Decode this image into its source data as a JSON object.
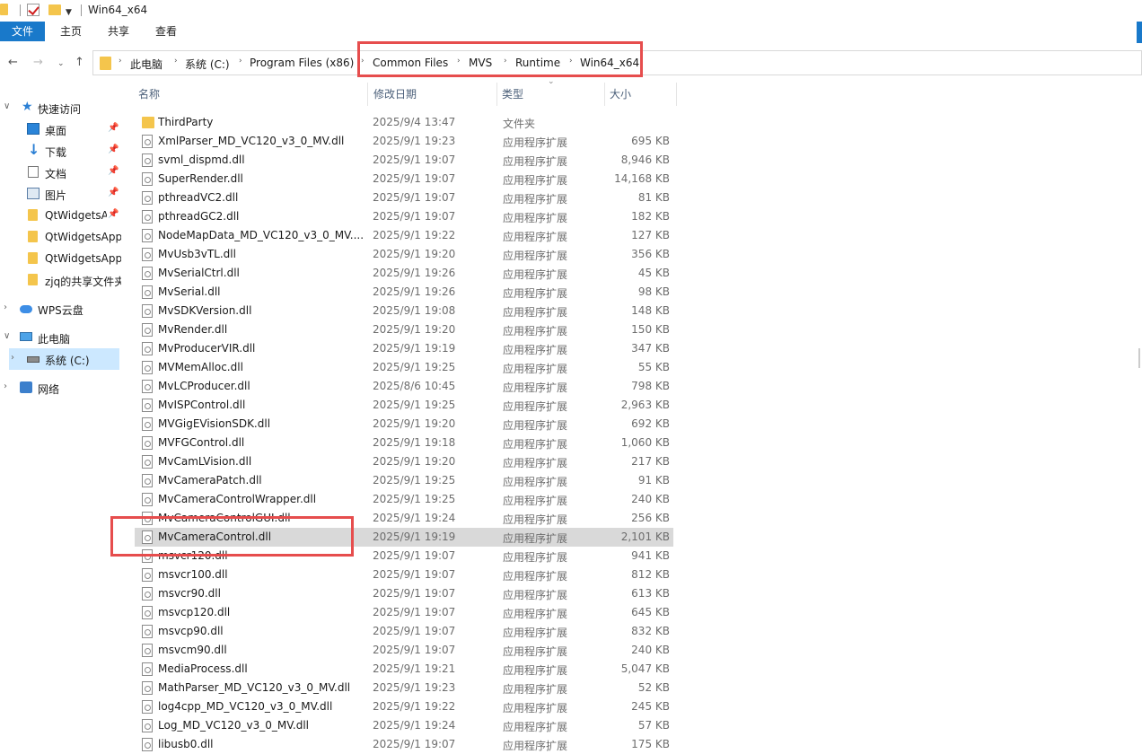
{
  "window": {
    "title": "Win64_x64"
  },
  "ribbon": {
    "tabs": [
      "文件",
      "主页",
      "共享",
      "查看"
    ]
  },
  "address": {
    "crumbs": [
      "此电脑",
      "系统 (C:)",
      "Program Files (x86)",
      "Common Files",
      "MVS",
      "Runtime",
      "Win64_x64"
    ]
  },
  "navpane": {
    "quick_access": "快速访问",
    "items": [
      {
        "label": "桌面",
        "icon": "desktop-icon",
        "pinned": true
      },
      {
        "label": "下载",
        "icon": "download-icon",
        "pinned": true
      },
      {
        "label": "文档",
        "icon": "document-icon",
        "pinned": true
      },
      {
        "label": "图片",
        "icon": "picture-icon",
        "pinned": true
      },
      {
        "label": "QtWidgetsA",
        "icon": "folder-icon",
        "pinned": true
      },
      {
        "label": "QtWidgetsApp",
        "icon": "folder-icon",
        "pinned": false
      },
      {
        "label": "QtWidgetsApp",
        "icon": "folder-icon",
        "pinned": false
      },
      {
        "label": "zjq的共享文件夹",
        "icon": "shared-folder-icon",
        "pinned": false
      }
    ],
    "wps": "WPS云盘",
    "this_pc": "此电脑",
    "drive": "系统 (C:)",
    "network": "网络"
  },
  "columns": {
    "name": "名称",
    "date": "修改日期",
    "type": "类型",
    "size": "大小"
  },
  "files": [
    {
      "name": "ThirdParty",
      "date": "2025/9/4 13:47",
      "type": "文件夹",
      "size": "",
      "kind": "folder"
    },
    {
      "name": "XmlParser_MD_VC120_v3_0_MV.dll",
      "date": "2025/9/1 19:23",
      "type": "应用程序扩展",
      "size": "695 KB",
      "kind": "dll"
    },
    {
      "name": "svml_dispmd.dll",
      "date": "2025/9/1 19:07",
      "type": "应用程序扩展",
      "size": "8,946 KB",
      "kind": "dll"
    },
    {
      "name": "SuperRender.dll",
      "date": "2025/9/1 19:07",
      "type": "应用程序扩展",
      "size": "14,168 KB",
      "kind": "dll"
    },
    {
      "name": "pthreadVC2.dll",
      "date": "2025/9/1 19:07",
      "type": "应用程序扩展",
      "size": "81 KB",
      "kind": "dll"
    },
    {
      "name": "pthreadGC2.dll",
      "date": "2025/9/1 19:07",
      "type": "应用程序扩展",
      "size": "182 KB",
      "kind": "dll"
    },
    {
      "name": "NodeMapData_MD_VC120_v3_0_MV....",
      "date": "2025/9/1 19:22",
      "type": "应用程序扩展",
      "size": "127 KB",
      "kind": "dll"
    },
    {
      "name": "MvUsb3vTL.dll",
      "date": "2025/9/1 19:20",
      "type": "应用程序扩展",
      "size": "356 KB",
      "kind": "dll"
    },
    {
      "name": "MvSerialCtrl.dll",
      "date": "2025/9/1 19:26",
      "type": "应用程序扩展",
      "size": "45 KB",
      "kind": "dll"
    },
    {
      "name": "MvSerial.dll",
      "date": "2025/9/1 19:26",
      "type": "应用程序扩展",
      "size": "98 KB",
      "kind": "dll"
    },
    {
      "name": "MvSDKVersion.dll",
      "date": "2025/9/1 19:08",
      "type": "应用程序扩展",
      "size": "148 KB",
      "kind": "dll"
    },
    {
      "name": "MvRender.dll",
      "date": "2025/9/1 19:20",
      "type": "应用程序扩展",
      "size": "150 KB",
      "kind": "dll"
    },
    {
      "name": "MvProducerVIR.dll",
      "date": "2025/9/1 19:19",
      "type": "应用程序扩展",
      "size": "347 KB",
      "kind": "dll"
    },
    {
      "name": "MVMemAlloc.dll",
      "date": "2025/9/1 19:25",
      "type": "应用程序扩展",
      "size": "55 KB",
      "kind": "dll"
    },
    {
      "name": "MvLCProducer.dll",
      "date": "2025/8/6 10:45",
      "type": "应用程序扩展",
      "size": "798 KB",
      "kind": "dll"
    },
    {
      "name": "MvISPControl.dll",
      "date": "2025/9/1 19:25",
      "type": "应用程序扩展",
      "size": "2,963 KB",
      "kind": "dll"
    },
    {
      "name": "MVGigEVisionSDK.dll",
      "date": "2025/9/1 19:20",
      "type": "应用程序扩展",
      "size": "692 KB",
      "kind": "dll"
    },
    {
      "name": "MVFGControl.dll",
      "date": "2025/9/1 19:18",
      "type": "应用程序扩展",
      "size": "1,060 KB",
      "kind": "dll"
    },
    {
      "name": "MvCamLVision.dll",
      "date": "2025/9/1 19:20",
      "type": "应用程序扩展",
      "size": "217 KB",
      "kind": "dll"
    },
    {
      "name": "MvCameraPatch.dll",
      "date": "2025/9/1 19:25",
      "type": "应用程序扩展",
      "size": "91 KB",
      "kind": "dll"
    },
    {
      "name": "MvCameraControlWrapper.dll",
      "date": "2025/9/1 19:25",
      "type": "应用程序扩展",
      "size": "240 KB",
      "kind": "dll"
    },
    {
      "name": "MvCameraControlGUI.dll",
      "date": "2025/9/1 19:24",
      "type": "应用程序扩展",
      "size": "256 KB",
      "kind": "dll"
    },
    {
      "name": "MvCameraControl.dll",
      "date": "2025/9/1 19:19",
      "type": "应用程序扩展",
      "size": "2,101 KB",
      "kind": "dll",
      "selected": true
    },
    {
      "name": "msvcr120.dll",
      "date": "2025/9/1 19:07",
      "type": "应用程序扩展",
      "size": "941 KB",
      "kind": "dll"
    },
    {
      "name": "msvcr100.dll",
      "date": "2025/9/1 19:07",
      "type": "应用程序扩展",
      "size": "812 KB",
      "kind": "dll"
    },
    {
      "name": "msvcr90.dll",
      "date": "2025/9/1 19:07",
      "type": "应用程序扩展",
      "size": "613 KB",
      "kind": "dll"
    },
    {
      "name": "msvcp120.dll",
      "date": "2025/9/1 19:07",
      "type": "应用程序扩展",
      "size": "645 KB",
      "kind": "dll"
    },
    {
      "name": "msvcp90.dll",
      "date": "2025/9/1 19:07",
      "type": "应用程序扩展",
      "size": "832 KB",
      "kind": "dll"
    },
    {
      "name": "msvcm90.dll",
      "date": "2025/9/1 19:07",
      "type": "应用程序扩展",
      "size": "240 KB",
      "kind": "dll"
    },
    {
      "name": "MediaProcess.dll",
      "date": "2025/9/1 19:21",
      "type": "应用程序扩展",
      "size": "5,047 KB",
      "kind": "dll"
    },
    {
      "name": "MathParser_MD_VC120_v3_0_MV.dll",
      "date": "2025/9/1 19:23",
      "type": "应用程序扩展",
      "size": "52 KB",
      "kind": "dll"
    },
    {
      "name": "log4cpp_MD_VC120_v3_0_MV.dll",
      "date": "2025/9/1 19:22",
      "type": "应用程序扩展",
      "size": "245 KB",
      "kind": "dll"
    },
    {
      "name": "Log_MD_VC120_v3_0_MV.dll",
      "date": "2025/9/1 19:24",
      "type": "应用程序扩展",
      "size": "57 KB",
      "kind": "dll"
    },
    {
      "name": "libusb0.dll",
      "date": "2025/9/1 19:07",
      "type": "应用程序扩展",
      "size": "175 KB",
      "kind": "dll"
    }
  ],
  "colors": {
    "accent": "#1979ca",
    "selection": "#cce8ff",
    "row_selected": "#d9d9d9",
    "annotation": "#e64d4d"
  }
}
